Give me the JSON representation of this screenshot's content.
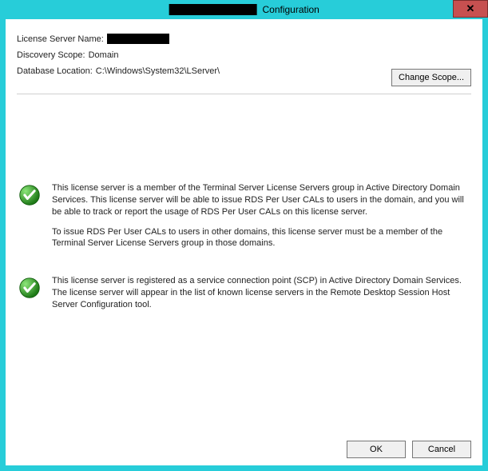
{
  "titlebar": {
    "title_suffix": "Configuration",
    "close_glyph": "✕"
  },
  "info": {
    "license_server_name_label": "License Server Name:",
    "discovery_scope_label": "Discovery Scope:",
    "discovery_scope_value": "Domain",
    "database_location_label": "Database Location:",
    "database_location_value": "C:\\Windows\\System32\\LServer\\",
    "change_scope_label": "Change Scope..."
  },
  "status": {
    "items": [
      {
        "para1": "This license server is a member of the Terminal Server License Servers group in Active Directory Domain Services. This license server will be able to issue RDS Per User CALs to users in the domain, and you will be able to track or report the usage of RDS Per User CALs on this license server.",
        "para2": "To issue RDS Per User CALs to users in other domains, this license server must be a member of the Terminal Server License Servers group in those domains."
      },
      {
        "para1": "This license server is registered as a service connection point (SCP) in Active Directory Domain Services. The license server will appear in the list of known license servers in the Remote Desktop Session Host Server Configuration tool.",
        "para2": ""
      }
    ]
  },
  "buttons": {
    "ok": "OK",
    "cancel": "Cancel"
  },
  "colors": {
    "teal": "#27cdd9",
    "close_red": "#c75050",
    "checkmark_green": "#34a62d"
  }
}
